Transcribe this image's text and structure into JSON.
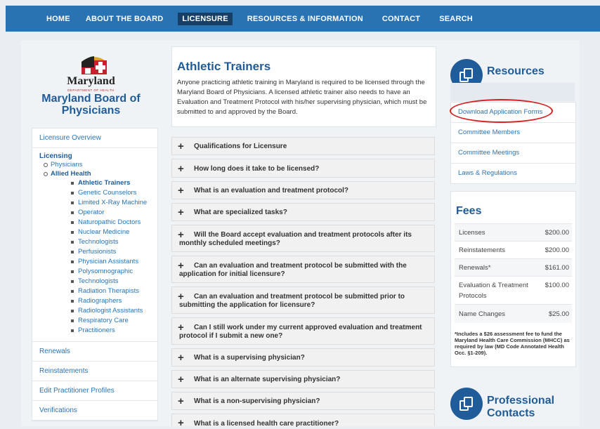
{
  "nav": {
    "items": [
      "HOME",
      "ABOUT THE BOARD",
      "LICENSURE",
      "RESOURCES & INFORMATION",
      "CONTACT",
      "SEARCH"
    ],
    "active": "LICENSURE"
  },
  "logo": {
    "state": "Maryland",
    "dept": "DEPARTMENT OF HEALTH",
    "title": "Maryland Board of Physicians"
  },
  "sidebar": {
    "overview": "Licensure Overview",
    "licensing": "Licensing",
    "physicians": "Physicians",
    "allied": "Allied Health",
    "sub": [
      {
        "label": "Athletic Trainers"
      },
      {
        "label": "Genetic Counselors"
      },
      {
        "label": "Limited X-Ray Machine",
        "cont": "Operator"
      },
      {
        "label": "Naturopathic Doctors"
      },
      {
        "label": "Nuclear Medicine",
        "cont": "Technologists"
      },
      {
        "label": "Perfusionists"
      },
      {
        "label": "Physician Assistants"
      },
      {
        "label": "Polysomnographic",
        "cont": "Technologists"
      },
      {
        "label": "Radiation Therapists"
      },
      {
        "label": "Radiographers"
      },
      {
        "label": "Radiologist Assistants"
      },
      {
        "label": "Respiratory Care",
        "cont": "Practitioners"
      }
    ],
    "bottom": [
      "Renewals",
      "Reinstatements",
      "Edit Practitioner Profiles",
      "Verifications"
    ]
  },
  "main": {
    "title": "Athletic Trainers",
    "intro": "Anyone practicing athletic training in Maryland is required to be licensed through the Maryland Board of Physicians. A licensed athletic trainer also needs to have an Evaluation and Treatment Protocol with his/her supervising physician, which must be submitted to and approved by the Board.",
    "faqs": [
      "Qualifications for Licensure",
      "How long does it take to be licensed?",
      "What is an evaluation and treatment protocol?",
      "What are specialized tasks?",
      "Will the Board accept evaluation and treatment protocols after its monthly scheduled meetings?",
      "Can an evaluation and treatment protocol be submitted with the application for initial licensure?",
      "Can an evaluation and treatment protocol be submitted prior to submitting the application for licensure?",
      "Can I still work under my current approved evaluation and treatment protocol if I submit a new one?",
      "What is a supervising physician?",
      "What is an alternate supervising physician?",
      "What is a non-supervising physician?",
      "What is a licensed health care practitioner?"
    ]
  },
  "resources": {
    "title": "Resources",
    "links": [
      "Download Application Forms",
      "Committee Members",
      "Committee Meetings",
      "Laws & Regulations"
    ]
  },
  "fees": {
    "title": "Fees",
    "rows": [
      {
        "name": "Licenses",
        "value": "$200.00"
      },
      {
        "name": "Reinstatements",
        "value": "$200.00"
      },
      {
        "name": "Renewals*",
        "value": "$161.00"
      },
      {
        "name": "Evaluation & Treatment Protocols",
        "value": "$100.00"
      },
      {
        "name": "Name Changes",
        "value": "$25.00"
      }
    ],
    "note": "*Includes a $26 assessment fee to fund the Maryland Health Care Commission (MHCC) as required by law (MD Code Annotated Health Occ. §1-209)."
  },
  "contacts": {
    "title": "Professional Contacts"
  },
  "colors": {
    "nav": "#2a73b3",
    "brand": "#1f5c99",
    "annotation": "#d62020"
  }
}
